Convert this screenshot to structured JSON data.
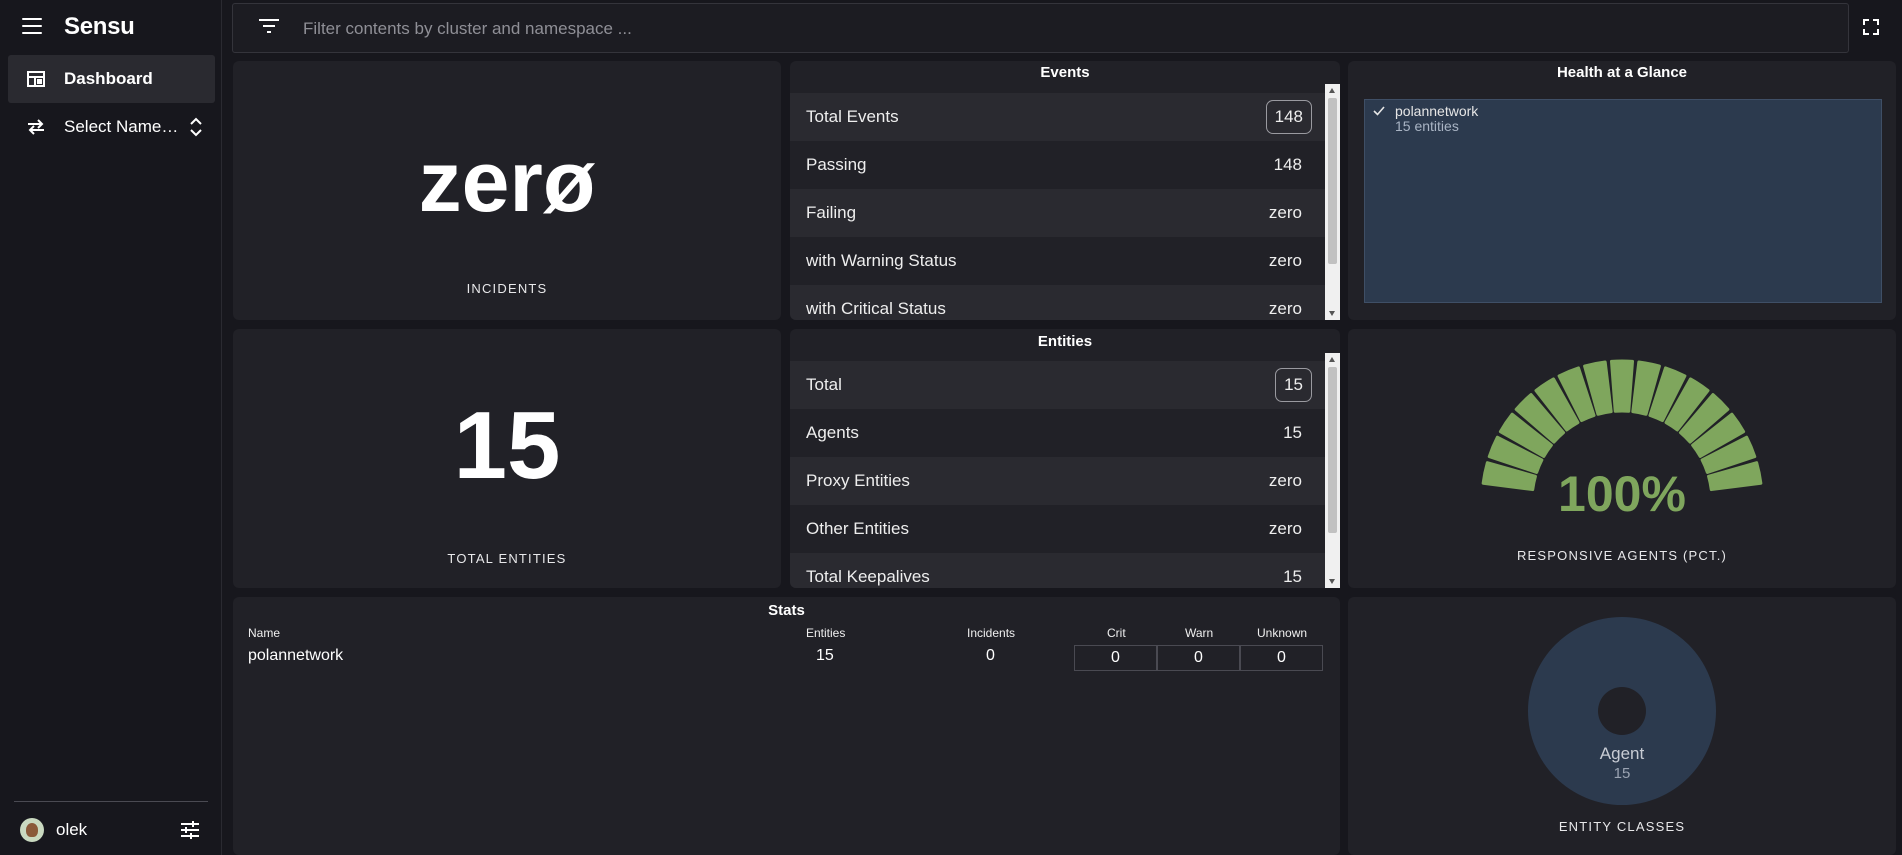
{
  "app": {
    "name": "Sensu"
  },
  "sidebar": {
    "items": [
      {
        "label": "Dashboard",
        "icon": "dashboard-icon",
        "active": true
      },
      {
        "label": "Select Name…",
        "icon": "swap-icon"
      }
    ],
    "user": {
      "name": "olek"
    }
  },
  "filter": {
    "placeholder": "Filter contents by cluster and namespace ..."
  },
  "incidents": {
    "value": "zerø",
    "caption": "INCIDENTS"
  },
  "total_entities": {
    "value": "15",
    "caption": "TOTAL ENTITIES"
  },
  "events": {
    "title": "Events",
    "rows": [
      {
        "label": "Total Events",
        "value": "148"
      },
      {
        "label": "Passing",
        "value": "148"
      },
      {
        "label": "Failing",
        "value": "zero"
      },
      {
        "label": "with Warning Status",
        "value": "zero"
      },
      {
        "label": "with Critical Status",
        "value": "zero"
      }
    ]
  },
  "entities": {
    "title": "Entities",
    "rows": [
      {
        "label": "Total",
        "value": "15"
      },
      {
        "label": "Agents",
        "value": "15"
      },
      {
        "label": "Proxy Entities",
        "value": "zero"
      },
      {
        "label": "Other Entities",
        "value": "zero"
      },
      {
        "label": "Total Keepalives",
        "value": "15"
      }
    ]
  },
  "health": {
    "title": "Health at a Glance",
    "items": [
      {
        "name": "polannetwork",
        "sub": "15 entities"
      }
    ]
  },
  "responsive": {
    "value": "100%",
    "percent": 100,
    "caption": "RESPONSIVE AGENTS (PCT.)",
    "color": "#7fa65d"
  },
  "stats": {
    "title": "Stats",
    "headers": {
      "name": "Name",
      "entities": "Entities",
      "incidents": "Incidents",
      "crit": "Crit",
      "warn": "Warn",
      "unknown": "Unknown"
    },
    "rows": [
      {
        "name": "polannetwork",
        "entities": "15",
        "incidents": "0",
        "crit": "0",
        "warn": "0",
        "unknown": "0"
      }
    ]
  },
  "entity_classes": {
    "caption": "ENTITY CLASSES",
    "slices": [
      {
        "label": "Agent",
        "value": "15"
      }
    ],
    "color": "#2c3a4e"
  }
}
